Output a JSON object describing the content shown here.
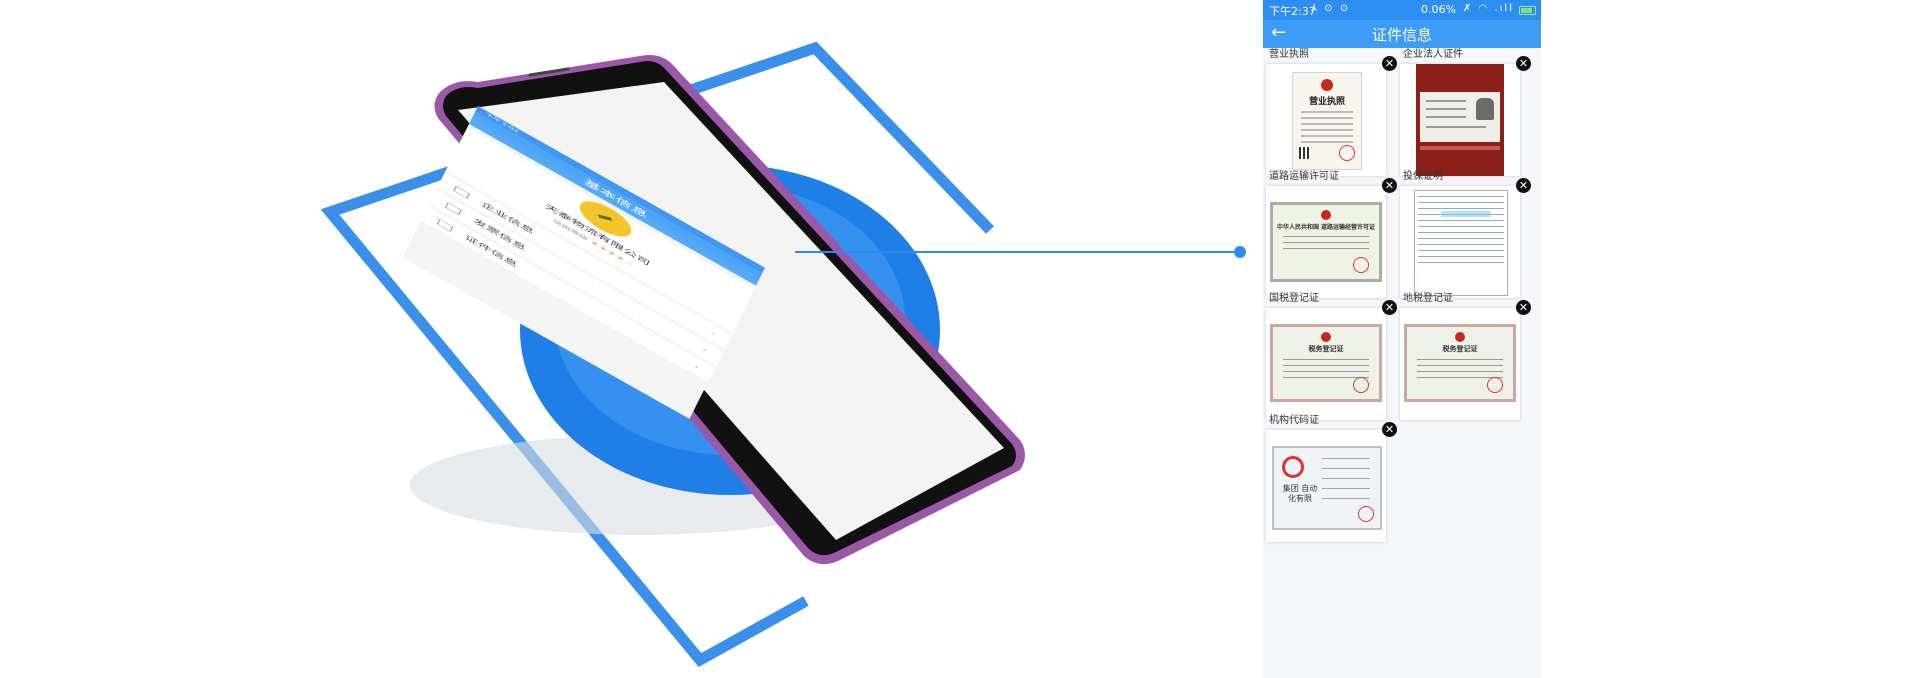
{
  "hero_phone": {
    "status": "下午3:02",
    "header_title": "基本信息",
    "company_name": "天泰物流有限公司",
    "company_sub": "信用等级",
    "stars": "★★★★☆",
    "menu": [
      {
        "label": "企业信息",
        "icon": "building-icon"
      },
      {
        "label": "发票信息",
        "icon": "invoice-icon"
      },
      {
        "label": "证件信息",
        "icon": "card-icon"
      }
    ],
    "arrow": "›",
    "colors": {
      "accent": "#3d9cf5",
      "frame": "#3a8fea",
      "disc": "#3b94f2"
    }
  },
  "status_bar": {
    "time": "下午2:37",
    "left_icons": "⅄ ⊙ ⊙",
    "percent": "0.06%",
    "right_icons": "✗ ◠ .ıll"
  },
  "nav": {
    "back": "←",
    "title": "证件信息"
  },
  "certificates": [
    {
      "label": "营业执照",
      "doc_title": "营业执照",
      "type": "business-license"
    },
    {
      "label": "企业法人证件",
      "type": "id-card"
    },
    {
      "label": "道路运输许可证",
      "doc_title": "中华人民共和国 道路运输经营许可证",
      "type": "transport-permit"
    },
    {
      "label": "投保证明",
      "type": "insurance-proof"
    },
    {
      "label": "国税登记证",
      "doc_title": "税务登记证",
      "type": "tax-certificate"
    },
    {
      "label": "地税登记证",
      "doc_title": "税务登记证",
      "type": "tax-certificate"
    },
    {
      "label": "机构代码证",
      "seal_text": "集团 自动化有限",
      "type": "org-code"
    }
  ],
  "delete_symbol": "✕"
}
